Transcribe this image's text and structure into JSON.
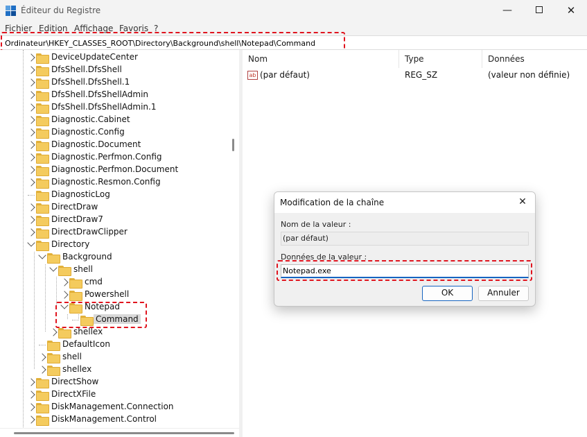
{
  "window": {
    "title": "Éditeur du Registre",
    "min_glyph": "—",
    "close_glyph": "✕"
  },
  "menu": [
    "Fichier",
    "Edition",
    "Affichage",
    "Favoris",
    "?"
  ],
  "address": "Ordinateur\\HKEY_CLASSES_ROOT\\Directory\\Background\\shell\\Notepad\\Command",
  "tree": [
    {
      "label": "DeviceUpdateCenter",
      "depth": 0,
      "state": "collapsed"
    },
    {
      "label": "DfsShell.DfsShell",
      "depth": 0,
      "state": "collapsed"
    },
    {
      "label": "DfsShell.DfsShell.1",
      "depth": 0,
      "state": "collapsed"
    },
    {
      "label": "DfsShell.DfsShellAdmin",
      "depth": 0,
      "state": "collapsed"
    },
    {
      "label": "DfsShell.DfsShellAdmin.1",
      "depth": 0,
      "state": "collapsed"
    },
    {
      "label": "Diagnostic.Cabinet",
      "depth": 0,
      "state": "collapsed"
    },
    {
      "label": "Diagnostic.Config",
      "depth": 0,
      "state": "collapsed"
    },
    {
      "label": "Diagnostic.Document",
      "depth": 0,
      "state": "collapsed"
    },
    {
      "label": "Diagnostic.Perfmon.Config",
      "depth": 0,
      "state": "collapsed"
    },
    {
      "label": "Diagnostic.Perfmon.Document",
      "depth": 0,
      "state": "collapsed"
    },
    {
      "label": "Diagnostic.Resmon.Config",
      "depth": 0,
      "state": "collapsed"
    },
    {
      "label": "DiagnosticLog",
      "depth": 0,
      "state": "leaf"
    },
    {
      "label": "DirectDraw",
      "depth": 0,
      "state": "collapsed"
    },
    {
      "label": "DirectDraw7",
      "depth": 0,
      "state": "collapsed"
    },
    {
      "label": "DirectDrawClipper",
      "depth": 0,
      "state": "collapsed"
    },
    {
      "label": "Directory",
      "depth": 0,
      "state": "expanded"
    },
    {
      "label": "Background",
      "depth": 1,
      "state": "expanded"
    },
    {
      "label": "shell",
      "depth": 2,
      "state": "expanded"
    },
    {
      "label": "cmd",
      "depth": 3,
      "state": "collapsed"
    },
    {
      "label": "Powershell",
      "depth": 3,
      "state": "collapsed"
    },
    {
      "label": "Notepad",
      "depth": 3,
      "state": "expanded"
    },
    {
      "label": "Command",
      "depth": 4,
      "state": "leaf",
      "selected": true
    },
    {
      "label": "shellex",
      "depth": 2,
      "state": "collapsed"
    },
    {
      "label": "DefaultIcon",
      "depth": 1,
      "state": "leaf"
    },
    {
      "label": "shell",
      "depth": 1,
      "state": "collapsed"
    },
    {
      "label": "shellex",
      "depth": 1,
      "state": "collapsed"
    },
    {
      "label": "DirectShow",
      "depth": 0,
      "state": "collapsed"
    },
    {
      "label": "DirectXFile",
      "depth": 0,
      "state": "collapsed"
    },
    {
      "label": "DiskManagement.Connection",
      "depth": 0,
      "state": "collapsed"
    },
    {
      "label": "DiskManagement.Control",
      "depth": 0,
      "state": "collapsed"
    }
  ],
  "list": {
    "headers": {
      "name": "Nom",
      "type": "Type",
      "data": "Données"
    },
    "rows": [
      {
        "name": "(par défaut)",
        "type": "REG_SZ",
        "data": "(valeur non définie)",
        "icon_text": "ab"
      }
    ]
  },
  "dialog": {
    "title": "Modification de la chaîne",
    "close_glyph": "✕",
    "value_name_label": "Nom de la valeur :",
    "value_name": "(par défaut)",
    "value_data_label": "Données de la valeur :",
    "value_data": "Notepad.exe",
    "ok_label": "OK",
    "cancel_label": "Annuler"
  },
  "colors": {
    "highlight": "#e0141e",
    "accent": "#1664c0",
    "folder": "#f4cb5e"
  }
}
